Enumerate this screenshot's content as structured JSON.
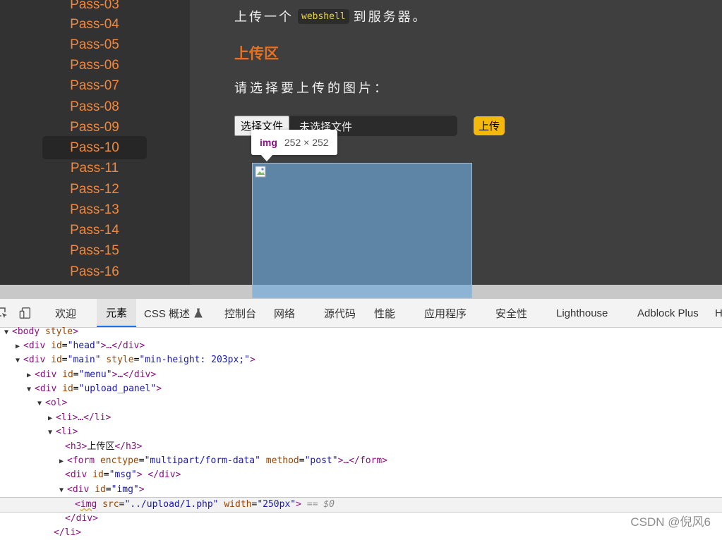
{
  "sidebar": {
    "items": [
      "Pass-03",
      "Pass-04",
      "Pass-05",
      "Pass-06",
      "Pass-07",
      "Pass-08",
      "Pass-09",
      "Pass-10",
      "Pass-11",
      "Pass-12",
      "Pass-13",
      "Pass-14",
      "Pass-15",
      "Pass-16"
    ],
    "active": "Pass-10"
  },
  "main": {
    "task_before": "上传一个",
    "task_code": "webshell",
    "task_after": "到服务器。",
    "section_title": "上传区",
    "prompt": "请选择要上传的图片：",
    "file_button": "选择文件",
    "file_status": "未选择文件",
    "upload_button": "上传"
  },
  "inspect_tooltip": {
    "tag": "img",
    "dims": "252 × 252"
  },
  "devtools": {
    "tabs": [
      "欢迎",
      "元素",
      "CSS 概述",
      "控制台",
      "网络",
      "源代码",
      "性能",
      "应用程序",
      "安全性",
      "Lighthouse",
      "Adblock Plus",
      "H"
    ],
    "active_tab": "元素",
    "icons": [
      "inspect-icon",
      "device-toggle-icon",
      "flask-icon"
    ]
  },
  "dom": {
    "body_tag": "<body",
    "body_attr": "style",
    "body_end": ">",
    "head": {
      "open": "<div",
      "attr": "id",
      "val": "\"head\"",
      "rest": ">…</div>"
    },
    "main": {
      "open": "<div",
      "attr1": "id",
      "val1": "\"main\"",
      "attr2": "style",
      "val2": "\"min-height: 203px;\"",
      "end": ">"
    },
    "menu": {
      "open": "<div",
      "attr": "id",
      "val": "\"menu\"",
      "rest": ">…</div>"
    },
    "upload_panel": {
      "open": "<div",
      "attr": "id",
      "val": "\"upload_panel\"",
      "end": ">"
    },
    "ol": "<ol>",
    "li_collapsed": "<li>…</li>",
    "li_open": "<li>",
    "h3_open": "<h3>",
    "h3_text": "上传区",
    "h3_close": "</h3>",
    "form": {
      "open": "<form",
      "attr1": "enctype",
      "val1": "\"multipart/form-data\"",
      "attr2": "method",
      "val2": "\"post\"",
      "rest": ">…</form>"
    },
    "msg": {
      "open": "<div",
      "attr": "id",
      "val": "\"msg\"",
      "rest": "> </div>"
    },
    "imgdiv": {
      "open": "<div",
      "attr": "id",
      "val": "\"img\"",
      "end": ">"
    },
    "img": {
      "lt": "<",
      "tag": "img",
      "attr1": "src",
      "val1": "\"../upload/1.php\"",
      "attr2": "width",
      "val2": "\"250px\"",
      "end": ">",
      "eq": "== $0"
    },
    "div_close": "</div>",
    "li_close": "</li>"
  },
  "watermark": "CSDN @倪风6"
}
